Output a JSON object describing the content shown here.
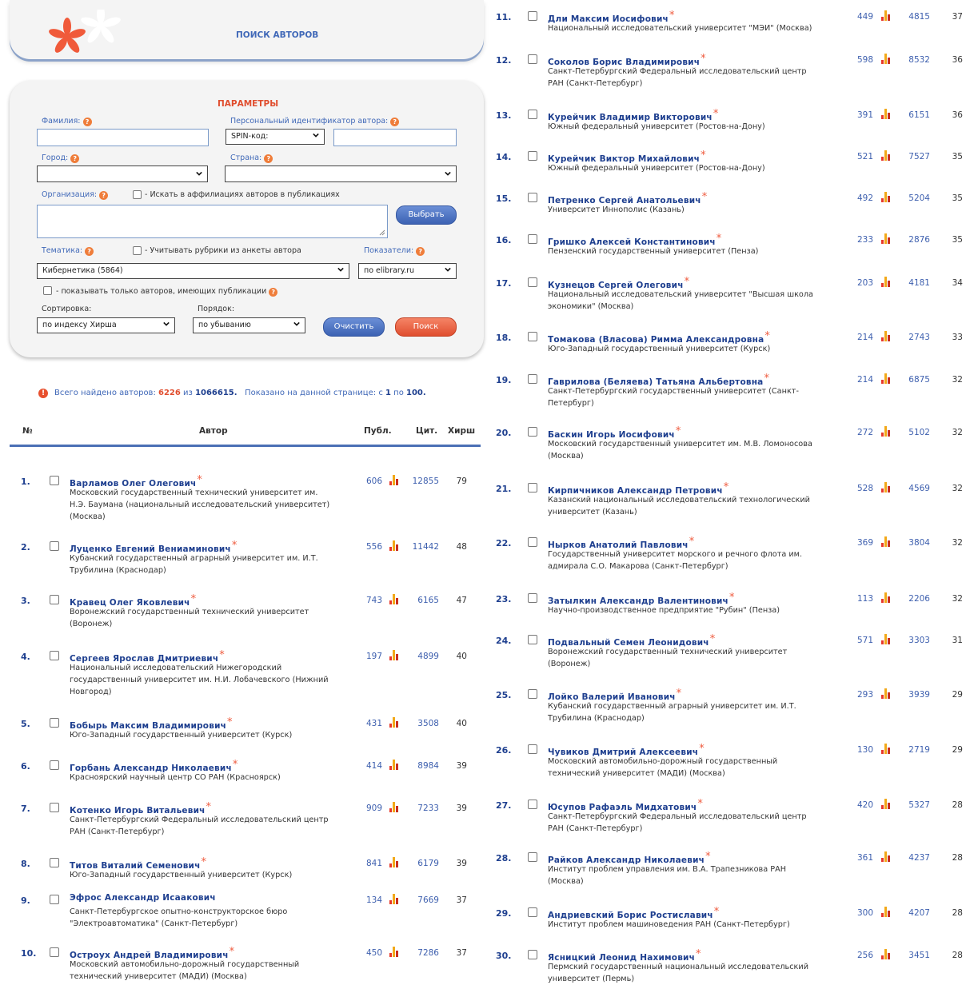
{
  "header": {
    "title": "ПОИСК АВТОРОВ"
  },
  "params": {
    "title": "ПАРАМЕТРЫ",
    "surname_label": "Фамилия:",
    "id_label": "Персональный идентификатор автора:",
    "id_type_value": "SPIN-код:",
    "city_label": "Город:",
    "country_label": "Страна:",
    "org_label": "Организация:",
    "affil_checkbox_label": "- Искать в аффилиациях авторов в публикациях",
    "choose_button": "Выбрать",
    "topic_label": "Тематика:",
    "rubric_checkbox_label": "- Учитывать рубрики из анкеты автора",
    "indicators_label": "Показатели:",
    "topic_value": "Кибернетика  (5864)",
    "indicators_value": "по elibrary.ru",
    "only_with_pubs_label": "- показывать только авторов, имеющих публикации",
    "sort_label": "Сортировка:",
    "sort_value": "по индексу Хирша",
    "order_label": "Порядок:",
    "order_value": "по убыванию",
    "clear_button": "Очистить",
    "search_button": "Поиск"
  },
  "summary": {
    "found_prefix": "Всего найдено авторов:",
    "found": "6226",
    "of": "из",
    "total": "1066615.",
    "shown_prefix": "Показано на данной странице: с",
    "from": "1",
    "to_word": "по",
    "to": "100."
  },
  "table": {
    "columns": {
      "num": "№",
      "author": "Автор",
      "pubs": "Публ.",
      "cites": "Цит.",
      "hirsch": "Хирш"
    },
    "left_rows": [
      {
        "num": "1.",
        "name": "Варламов Олег Олегович",
        "star": true,
        "aff": [
          "Московский государственный технический университет им.",
          "Н.Э. Баумана (национальный исследовательский университет)",
          "(Москва)"
        ],
        "pubs": "606",
        "cites": "12855",
        "h": "79"
      },
      {
        "num": "2.",
        "name": "Луценко Евгений Вениаминович",
        "star": true,
        "aff": [
          "Кубанский государственный аграрный университет им. И.Т.",
          "Трубилина (Краснодар)"
        ],
        "pubs": "556",
        "cites": "11442",
        "h": "48"
      },
      {
        "num": "3.",
        "name": "Кравец Олег Яковлевич",
        "star": true,
        "aff": [
          "Воронежский государственный технический университет",
          "(Воронеж)"
        ],
        "pubs": "743",
        "cites": "6165",
        "h": "47"
      },
      {
        "num": "4.",
        "name": "Сергеев Ярослав Дмитриевич",
        "star": true,
        "aff": [
          "Национальный исследовательский Нижегородский",
          "государственный университет им. Н.И. Лобачевского (Нижний",
          "Новгород)"
        ],
        "pubs": "197",
        "cites": "4899",
        "h": "40"
      },
      {
        "num": "5.",
        "name": "Бобырь Максим Владимирович",
        "star": true,
        "aff": [
          "Юго-Западный государственный университет (Курск)"
        ],
        "pubs": "431",
        "cites": "3508",
        "h": "40"
      },
      {
        "num": "6.",
        "name": "Горбань Александр Николаевич",
        "star": true,
        "aff": [
          "Красноярский научный центр СО РАН (Красноярск)"
        ],
        "pubs": "414",
        "cites": "8984",
        "h": "39"
      },
      {
        "num": "7.",
        "name": "Котенко Игорь Витальевич",
        "star": true,
        "aff": [
          "Санкт-Петербургский Федеральный исследовательский центр",
          "РАН (Санкт-Петербург)"
        ],
        "pubs": "909",
        "cites": "7233",
        "h": "39"
      },
      {
        "num": "8.",
        "name": "Титов Виталий Семенович",
        "star": true,
        "aff": [
          "Юго-Западный государственный университет (Курск)"
        ],
        "pubs": "841",
        "cites": "6179",
        "h": "39"
      },
      {
        "num": "9.",
        "name": "Эфрос Александр Исаакович",
        "star": false,
        "aff": [
          "Санкт-Петербургское опытно-конструкторское бюро",
          "\"Электроавтоматика\" (Санкт-Петербург)"
        ],
        "pubs": "134",
        "cites": "7669",
        "h": "37"
      },
      {
        "num": "10.",
        "name": "Остроух Андрей Владимирович",
        "star": true,
        "aff": [
          "Московский автомобильно-дорожный государственный",
          "технический университет (МАДИ) (Москва)"
        ],
        "pubs": "450",
        "cites": "7286",
        "h": "37"
      }
    ],
    "right_rows": [
      {
        "num": "11.",
        "name": "Дли Максим Иосифович",
        "star": true,
        "aff": [
          "Национальный исследовательский университет \"МЭИ\" (Москва)"
        ],
        "pubs": "449",
        "cites": "4815",
        "h": "37"
      },
      {
        "num": "12.",
        "name": "Соколов Борис Владимирович",
        "star": true,
        "aff": [
          "Санкт-Петербургский Федеральный исследовательский центр",
          "РАН (Санкт-Петербург)"
        ],
        "pubs": "598",
        "cites": "8532",
        "h": "36"
      },
      {
        "num": "13.",
        "name": "Курейчик Владимир Викторович",
        "star": true,
        "aff": [
          "Южный федеральный университет (Ростов-на-Дону)"
        ],
        "pubs": "391",
        "cites": "6151",
        "h": "36"
      },
      {
        "num": "14.",
        "name": "Курейчик Виктор Михайлович",
        "star": true,
        "aff": [
          "Южный федеральный университет (Ростов-на-Дону)"
        ],
        "pubs": "521",
        "cites": "7527",
        "h": "35"
      },
      {
        "num": "15.",
        "name": "Петренко Сергей Анатольевич",
        "star": true,
        "aff": [
          "Университет Иннополис (Казань)"
        ],
        "pubs": "492",
        "cites": "5204",
        "h": "35"
      },
      {
        "num": "16.",
        "name": "Гришко Алексей Константинович",
        "star": true,
        "aff": [
          "Пензенский государственный университет (Пенза)"
        ],
        "pubs": "233",
        "cites": "2876",
        "h": "35"
      },
      {
        "num": "17.",
        "name": "Кузнецов Сергей Олегович",
        "star": true,
        "aff": [
          "Национальный исследовательский университет \"Высшая школа",
          "экономики\" (Москва)"
        ],
        "pubs": "203",
        "cites": "4181",
        "h": "34"
      },
      {
        "num": "18.",
        "name": "Томакова (Власова) Римма Александровна",
        "star": true,
        "aff": [
          "Юго-Западный государственный университет (Курск)"
        ],
        "pubs": "214",
        "cites": "2743",
        "h": "33"
      },
      {
        "num": "19.",
        "name": "Гаврилова (Беляева) Татьяна Альбертовна",
        "star": true,
        "aff": [
          "Санкт-Петербургский государственный университет (Санкт-",
          "Петербург)"
        ],
        "pubs": "214",
        "cites": "6875",
        "h": "32"
      },
      {
        "num": "20.",
        "name": "Баскин Игорь Иосифович",
        "star": true,
        "aff": [
          "Московский государственный университет им. М.В. Ломоносова",
          "(Москва)"
        ],
        "pubs": "272",
        "cites": "5102",
        "h": "32"
      },
      {
        "num": "21.",
        "name": "Кирпичников Александр Петрович",
        "star": true,
        "aff": [
          "Казанский национальный исследовательский технологический",
          "университет (Казань)"
        ],
        "pubs": "528",
        "cites": "4569",
        "h": "32"
      },
      {
        "num": "22.",
        "name": "Нырков Анатолий Павлович",
        "star": true,
        "aff": [
          "Государственный университет морского и речного флота им.",
          "адмирала С.О. Макарова (Санкт-Петербург)"
        ],
        "pubs": "369",
        "cites": "3804",
        "h": "32"
      },
      {
        "num": "23.",
        "name": "Затылкин Александр Валентинович",
        "star": true,
        "aff": [
          "Научно-производственное предприятие \"Рубин\" (Пенза)"
        ],
        "pubs": "113",
        "cites": "2206",
        "h": "32"
      },
      {
        "num": "24.",
        "name": "Подвальный Семен Леонидович",
        "star": true,
        "aff": [
          "Воронежский государственный технический университет",
          "(Воронеж)"
        ],
        "pubs": "571",
        "cites": "3303",
        "h": "31"
      },
      {
        "num": "25.",
        "name": "Лойко Валерий Иванович",
        "star": true,
        "aff": [
          "Кубанский государственный аграрный университет им. И.Т.",
          "Трубилина (Краснодар)"
        ],
        "pubs": "293",
        "cites": "3939",
        "h": "29"
      },
      {
        "num": "26.",
        "name": "Чувиков Дмитрий Алексеевич",
        "star": true,
        "aff": [
          "Московский автомобильно-дорожный государственный",
          "технический университет (МАДИ) (Москва)"
        ],
        "pubs": "130",
        "cites": "2719",
        "h": "29"
      },
      {
        "num": "27.",
        "name": "Юсупов Рафаэль Мидхатович",
        "star": true,
        "aff": [
          "Санкт-Петербургский Федеральный исследовательский центр",
          "РАН (Санкт-Петербург)"
        ],
        "pubs": "420",
        "cites": "5327",
        "h": "28"
      },
      {
        "num": "28.",
        "name": "Райков Александр Николаевич",
        "star": true,
        "aff": [
          "Институт проблем управления им. В.А. Трапезникова РАН",
          "(Москва)"
        ],
        "pubs": "361",
        "cites": "4237",
        "h": "28"
      },
      {
        "num": "29.",
        "name": "Андриевский Борис Ростиславич",
        "star": true,
        "aff": [
          "Институт проблем машиноведения РАН (Санкт-Петербург)"
        ],
        "pubs": "300",
        "cites": "4207",
        "h": "28"
      },
      {
        "num": "30.",
        "name": "Ясницкий Леонид Нахимович",
        "star": true,
        "aff": [
          "Пермский государственный национальный исследовательский",
          "университет (Пермь)"
        ],
        "pubs": "256",
        "cites": "3451",
        "h": "28"
      }
    ]
  }
}
